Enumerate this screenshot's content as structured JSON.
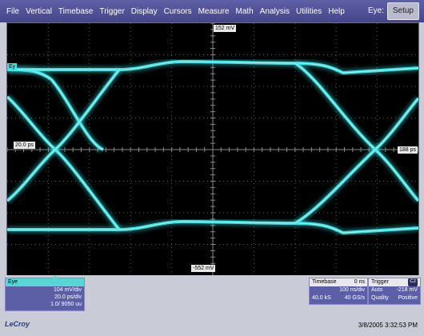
{
  "menubar": {
    "items": [
      "File",
      "Vertical",
      "Timebase",
      "Trigger",
      "Display",
      "Cursors",
      "Measure",
      "Math",
      "Analysis",
      "Utilities",
      "Help"
    ],
    "mode_label": "Eye:",
    "setup_label": "Setup"
  },
  "grid": {
    "top_marker": "152 mV",
    "bottom_marker": "-552 mV",
    "left_marker": "20.0 ps",
    "right_marker": "188 ps",
    "left_edge_marker": "Ey",
    "trace_color": "#3fe4e4"
  },
  "eye_panel": {
    "title": "Eye",
    "volts_per_div": "104 mV/div",
    "time_per_div": "20.0 ps/div",
    "count": "1.0/ 9050 uu"
  },
  "timebase_panel": {
    "title": "Timebase",
    "delay": "0 ns",
    "rate_left": "",
    "rate": "100 ns/div",
    "samples": "40.0 kS",
    "sample_rate": "40 GS/s"
  },
  "trigger_panel": {
    "title": "Trigger",
    "channel_badge": "C2",
    "mode": "Auto",
    "level": "-218 mV",
    "quality_label": "Quality",
    "slope": "Positive"
  },
  "logo_text": "LeCroy",
  "timestamp": "3/8/2005 3:32:53 PM"
}
